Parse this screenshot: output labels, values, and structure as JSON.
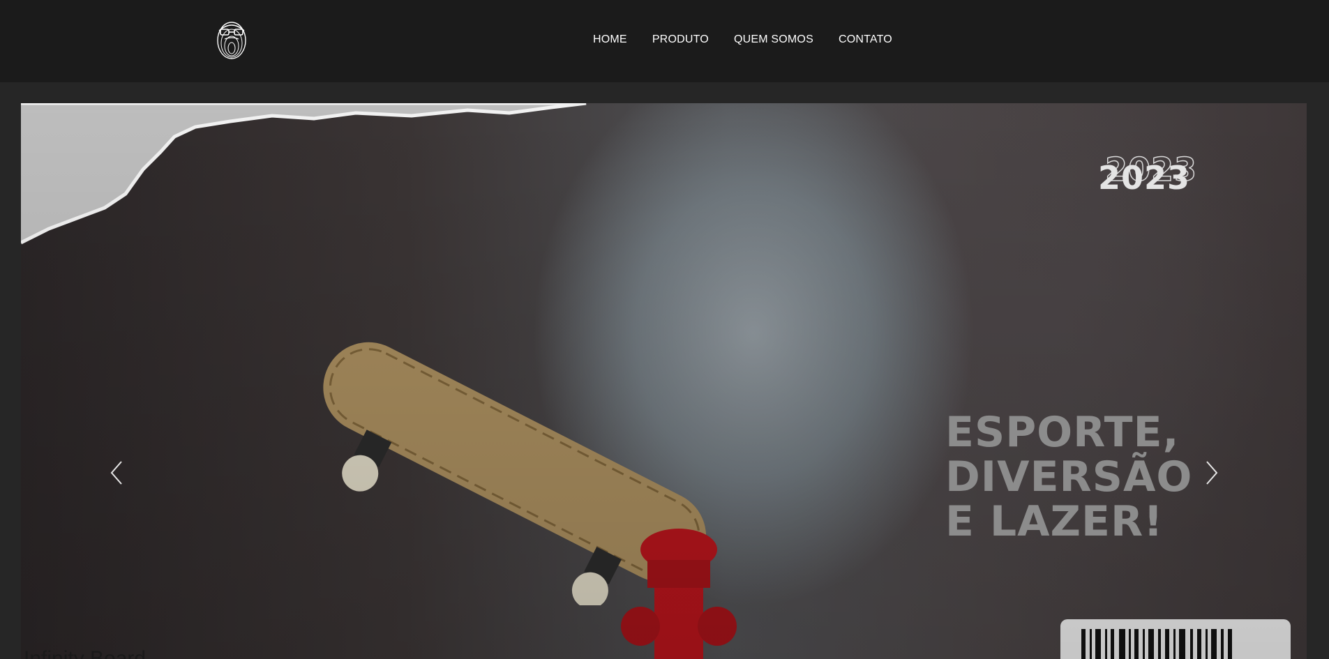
{
  "header": {
    "logo_icon": "bearded-face-fingerprint-logo",
    "nav": [
      {
        "label": "HOME"
      },
      {
        "label": "PRODUTO"
      },
      {
        "label": "QUEM SOMOS"
      },
      {
        "label": "CONTATO"
      }
    ]
  },
  "hero": {
    "year": "2023",
    "slogan": "ESPORTE,\nDIVERSÃO\nE LAZER!",
    "caption": "Infinity Board",
    "prev_icon": "chevron-left-icon",
    "next_icon": "chevron-right-icon"
  },
  "colors": {
    "header_bg": "#1b1b1b",
    "page_bg": "#262626",
    "nav_text": "#ffffff",
    "slogan": "#8c8c8c"
  }
}
